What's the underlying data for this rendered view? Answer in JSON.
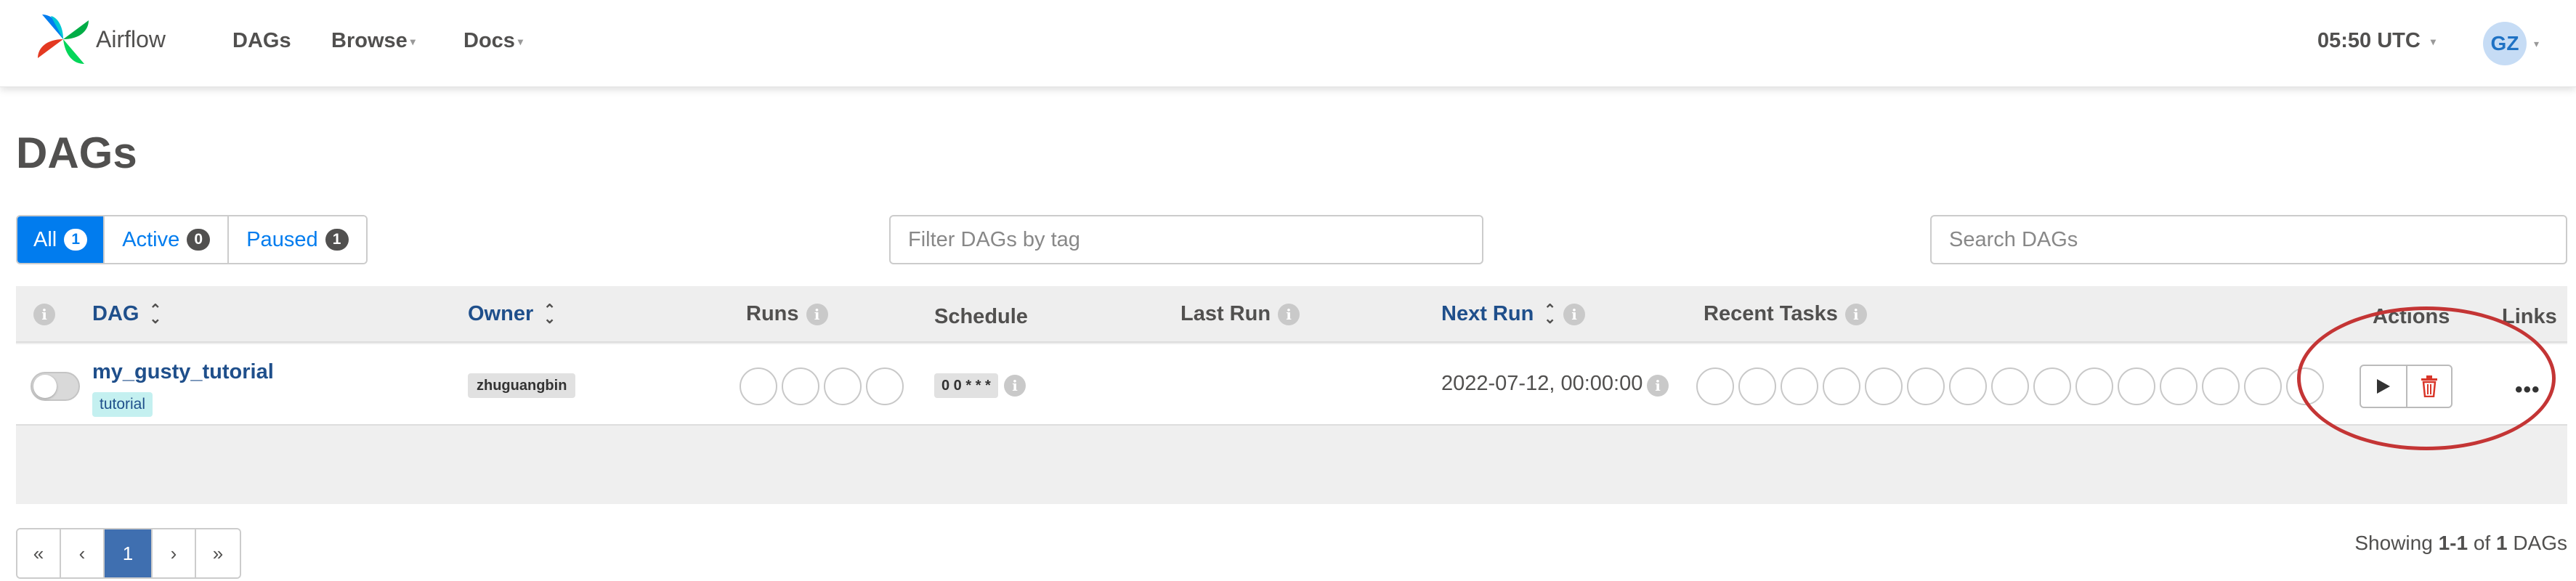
{
  "navbar": {
    "brand": "Airflow",
    "menu": [
      {
        "label": "DAGs",
        "dropdown": false
      },
      {
        "label": "Browse",
        "dropdown": true
      },
      {
        "label": "Docs",
        "dropdown": true
      }
    ],
    "time": "05:50 UTC",
    "user_initials": "GZ"
  },
  "page": {
    "title": "DAGs"
  },
  "status_filter": [
    {
      "label": "All",
      "count": "1",
      "active": true
    },
    {
      "label": "Active",
      "count": "0",
      "active": false
    },
    {
      "label": "Paused",
      "count": "1",
      "active": false
    }
  ],
  "tag_filter": {
    "placeholder": "Filter DAGs by tag"
  },
  "search": {
    "placeholder": "Search DAGs"
  },
  "table": {
    "headers": {
      "dag": "DAG",
      "owner": "Owner",
      "runs": "Runs",
      "schedule": "Schedule",
      "last_run": "Last Run",
      "next_run": "Next Run",
      "recent_tasks": "Recent Tasks",
      "actions": "Actions",
      "links": "Links"
    },
    "rows": [
      {
        "dag_id": "my_gusty_tutorial",
        "tag": "tutorial",
        "owner": "zhuguangbin",
        "schedule": "0 0 * * *",
        "last_run": "",
        "next_run": "2022-07-12, 00:00:00",
        "paused": true,
        "run_circles": 4,
        "task_circles": 15
      }
    ]
  },
  "pagination": {
    "first": "«",
    "prev": "‹",
    "current": "1",
    "next": "›",
    "last": "»"
  },
  "footer": {
    "showing_prefix": "Showing",
    "range": "1-1",
    "of": "of",
    "total": "1",
    "suffix": "DAGs"
  },
  "colors": {
    "primary": "#017cee",
    "link": "#1f4f8b",
    "tag_bg": "#c4f0f0",
    "annotation": "#c43535"
  }
}
